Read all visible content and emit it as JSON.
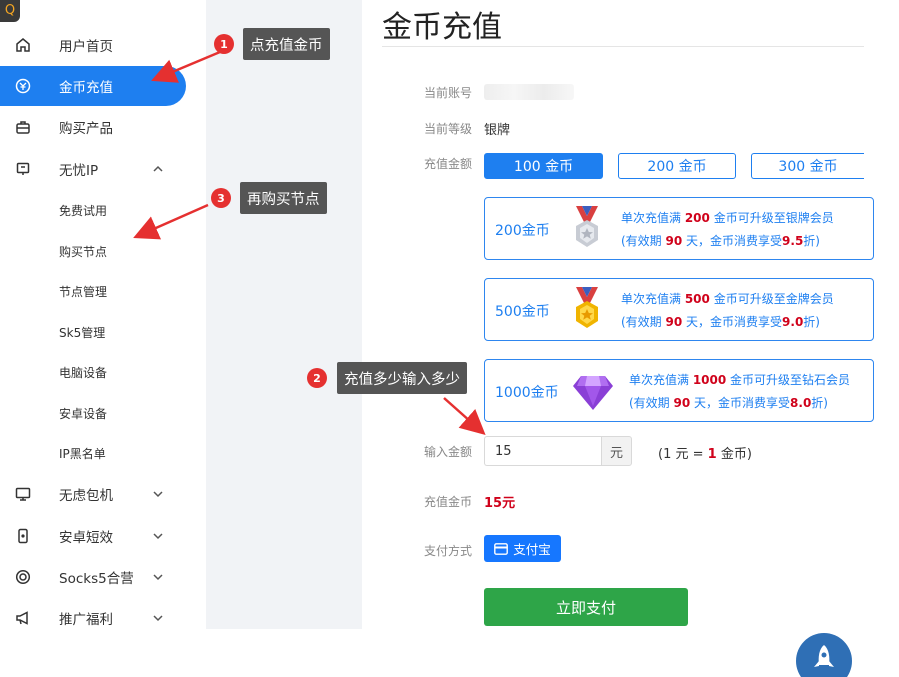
{
  "sidebar": {
    "logo_glyph": "Q",
    "items": [
      {
        "label": "用户首页"
      },
      {
        "label": "金币充值"
      },
      {
        "label": "购买产品"
      },
      {
        "label": "无忧IP"
      },
      {
        "label": "无虑包机"
      },
      {
        "label": "安卓短效"
      },
      {
        "label": "Socks5合营"
      },
      {
        "label": "推广福利"
      }
    ],
    "sub_items": [
      {
        "label": "免费试用"
      },
      {
        "label": "购买节点"
      },
      {
        "label": "节点管理"
      },
      {
        "label": "Sk5管理"
      },
      {
        "label": "电脑设备"
      },
      {
        "label": "安卓设备"
      },
      {
        "label": "IP黑名单"
      }
    ]
  },
  "main": {
    "title": "金币充值",
    "labels": {
      "account": "当前账号",
      "level": "当前等级",
      "amount": "充值金额",
      "input_amount": "输入金额",
      "charge_coins": "充值金币",
      "pay_method": "支付方式"
    },
    "level_value": "银牌",
    "amount_options": [
      {
        "label": "100 金币"
      },
      {
        "label": "200 金币"
      },
      {
        "label": "300 金币"
      }
    ],
    "tiers": [
      {
        "name": "200金币",
        "pre": "单次充值满 ",
        "amount": "200",
        "post": " 金币可升级至银牌会员",
        "l2_pre": "(有效期 ",
        "days": "90",
        "l2_mid": " 天，金币消费享受",
        "discount": "9.5",
        "l2_post": "折)"
      },
      {
        "name": "500金币",
        "pre": "单次充值满 ",
        "amount": "500",
        "post": " 金币可升级至金牌会员",
        "l2_pre": "(有效期 ",
        "days": "90",
        "l2_mid": " 天，金币消费享受",
        "discount": "9.0",
        "l2_post": "折)"
      },
      {
        "name": "1000金币",
        "pre": "单次充值满 ",
        "amount": "1000",
        "post": " 金币可升级至钻石会员",
        "l2_pre": "(有效期 ",
        "days": "90",
        "l2_mid": " 天，金币消费享受",
        "discount": "8.0",
        "l2_post": "折)"
      }
    ],
    "input_value": "15",
    "input_unit": "元",
    "rate_pre": "(1 元 = ",
    "rate_num": "1",
    "rate_post": " 金币)",
    "charge_value": "15元",
    "alipay_label": "支付宝",
    "pay_button": "立即支付"
  },
  "annotations": [
    {
      "num": "1",
      "text": "点充值金币"
    },
    {
      "num": "2",
      "text": "充值多少输入多少"
    },
    {
      "num": "3",
      "text": "再购买节点"
    }
  ],
  "colors": {
    "accent": "#1e7ff0",
    "pay_green": "#2ea548",
    "highlight_red": "#d0021b",
    "alipay": "#1677ff"
  }
}
